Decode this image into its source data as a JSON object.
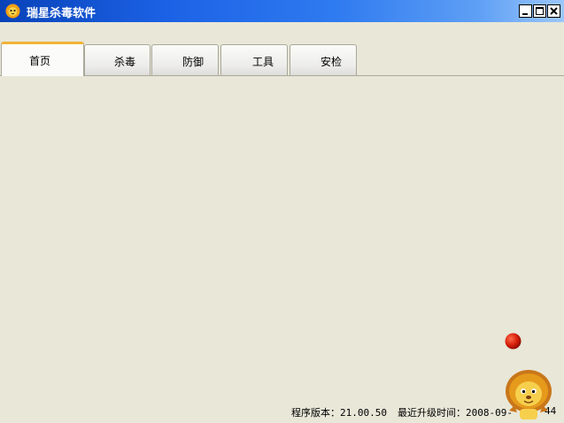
{
  "window": {
    "title": "瑞星杀毒软件",
    "controls": [
      "minimize",
      "maximize",
      "close"
    ]
  },
  "tabs": [
    {
      "label": "首页",
      "active": true
    },
    {
      "label": "杀毒",
      "active": false
    },
    {
      "label": "防御",
      "active": false
    },
    {
      "label": "工具",
      "active": false
    },
    {
      "label": "安检",
      "active": false
    }
  ],
  "status": {
    "version_label": "程序版本：21.00.50",
    "update_label": "最近升级时间：2008-09-",
    "update_tail": "44"
  },
  "mascot": {
    "icon": "lion-mascot-icon",
    "ball_icon": "red-ball-icon"
  },
  "colors": {
    "title_start": "#0842b8",
    "title_end": "#9cc7fb",
    "active_tab_accent": "#f2b338",
    "background": "#e8e7d8"
  }
}
